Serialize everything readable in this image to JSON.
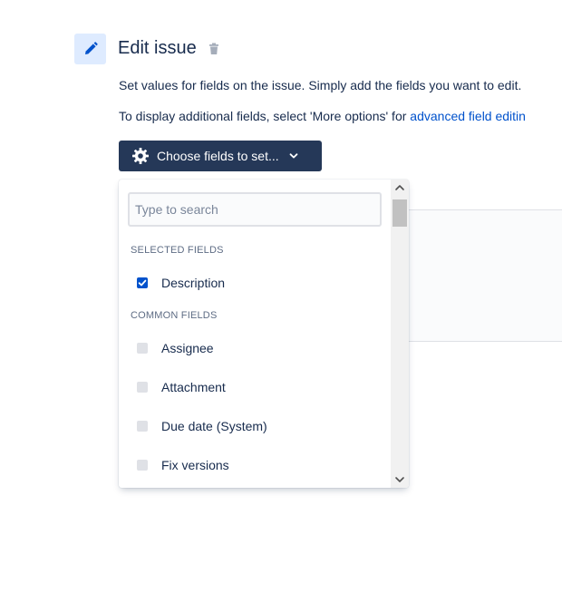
{
  "header": {
    "title": "Edit issue"
  },
  "description": {
    "line1": "Set values for fields on the issue. Simply add the fields you want to edit.",
    "line2_prefix": "To display additional fields, select 'More options' for ",
    "line2_link": "advanced field editin"
  },
  "choose_button": {
    "label": "Choose fields to set..."
  },
  "dropdown": {
    "search": {
      "placeholder": "Type to search",
      "value": ""
    },
    "selected_heading": "SELECTED FIELDS",
    "selected_fields": [
      {
        "label": "Description",
        "checked": true
      }
    ],
    "common_heading": "COMMON FIELDS",
    "common_fields": [
      {
        "label": "Assignee",
        "checked": false
      },
      {
        "label": "Attachment",
        "checked": false
      },
      {
        "label": "Due date (System)",
        "checked": false
      },
      {
        "label": "Fix versions",
        "checked": false
      }
    ]
  },
  "colors": {
    "accent": "#0052cc",
    "button_bg": "#253858",
    "icon_bg": "#deebff",
    "text": "#172b4d"
  },
  "icons": {
    "edit": "pencil-icon",
    "delete": "trash-icon",
    "settings": "gear-icon",
    "dropdown": "chevron-down-icon"
  }
}
